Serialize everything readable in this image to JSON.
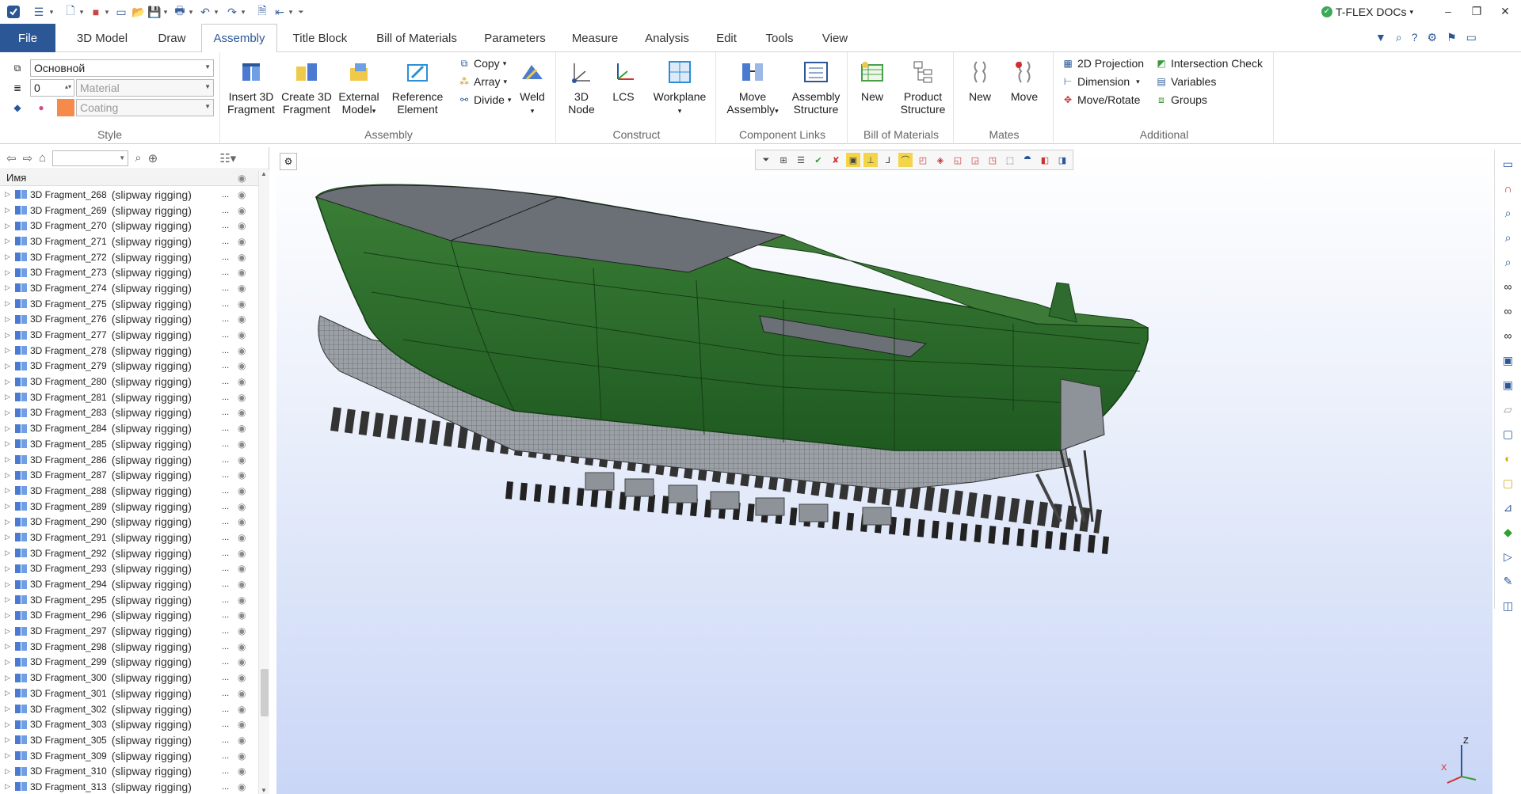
{
  "app": {
    "product": "T-FLEX DOCs"
  },
  "menu": {
    "file": "File",
    "tabs": [
      "3D Model",
      "Draw",
      "Assembly",
      "Title Block",
      "Bill of Materials",
      "Parameters",
      "Measure",
      "Analysis",
      "Edit",
      "Tools",
      "View"
    ],
    "active": "Assembly"
  },
  "ribbon": {
    "style": {
      "label": "Style",
      "layer_value": "Основной",
      "number_value": "0",
      "material_placeholder": "Material",
      "coating_placeholder": "Coating",
      "coating_color": "#f58a4b"
    },
    "assembly": {
      "label": "Assembly",
      "insert": "Insert 3D Fragment",
      "create": "Create 3D Fragment",
      "external": "External Model",
      "reference": "Reference Element",
      "copy": "Copy",
      "array": "Array",
      "divide": "Divide",
      "weld": "Weld"
    },
    "construct": {
      "label": "Construct",
      "node": "3D Node",
      "lcs": "LCS",
      "workplane": "Workplane"
    },
    "component_links": {
      "label": "Component Links",
      "move_assembly": "Move Assembly",
      "assembly_structure": "Assembly Structure"
    },
    "bom": {
      "label": "Bill of Materials",
      "new": "New",
      "product_structure": "Product Structure"
    },
    "mates": {
      "label": "Mates",
      "new": "New",
      "move": "Move"
    },
    "additional": {
      "label": "Additional",
      "projection": "2D Projection",
      "dimension": "Dimension",
      "move_rotate": "Move/Rotate",
      "intersection": "Intersection Check",
      "variables": "Variables",
      "groups": "Groups"
    }
  },
  "tree": {
    "header": "Имя",
    "rows": [
      {
        "name": "3D Fragment_268",
        "sub": "(slipway rigging)"
      },
      {
        "name": "3D Fragment_269",
        "sub": "(slipway rigging)"
      },
      {
        "name": "3D Fragment_270",
        "sub": "(slipway rigging)"
      },
      {
        "name": "3D Fragment_271",
        "sub": "(slipway rigging)"
      },
      {
        "name": "3D Fragment_272",
        "sub": "(slipway rigging)"
      },
      {
        "name": "3D Fragment_273",
        "sub": "(slipway rigging)"
      },
      {
        "name": "3D Fragment_274",
        "sub": "(slipway rigging)"
      },
      {
        "name": "3D Fragment_275",
        "sub": "(slipway rigging)"
      },
      {
        "name": "3D Fragment_276",
        "sub": "(slipway rigging)"
      },
      {
        "name": "3D Fragment_277",
        "sub": "(slipway rigging)"
      },
      {
        "name": "3D Fragment_278",
        "sub": "(slipway rigging)"
      },
      {
        "name": "3D Fragment_279",
        "sub": "(slipway rigging)"
      },
      {
        "name": "3D Fragment_280",
        "sub": "(slipway rigging)"
      },
      {
        "name": "3D Fragment_281",
        "sub": "(slipway rigging)"
      },
      {
        "name": "3D Fragment_283",
        "sub": "(slipway rigging)"
      },
      {
        "name": "3D Fragment_284",
        "sub": "(slipway rigging)"
      },
      {
        "name": "3D Fragment_285",
        "sub": "(slipway rigging)"
      },
      {
        "name": "3D Fragment_286",
        "sub": "(slipway rigging)"
      },
      {
        "name": "3D Fragment_287",
        "sub": "(slipway rigging)"
      },
      {
        "name": "3D Fragment_288",
        "sub": "(slipway rigging)"
      },
      {
        "name": "3D Fragment_289",
        "sub": "(slipway rigging)"
      },
      {
        "name": "3D Fragment_290",
        "sub": "(slipway rigging)"
      },
      {
        "name": "3D Fragment_291",
        "sub": "(slipway rigging)"
      },
      {
        "name": "3D Fragment_292",
        "sub": "(slipway rigging)"
      },
      {
        "name": "3D Fragment_293",
        "sub": "(slipway rigging)"
      },
      {
        "name": "3D Fragment_294",
        "sub": "(slipway rigging)"
      },
      {
        "name": "3D Fragment_295",
        "sub": "(slipway rigging)"
      },
      {
        "name": "3D Fragment_296",
        "sub": "(slipway rigging)"
      },
      {
        "name": "3D Fragment_297",
        "sub": "(slipway rigging)"
      },
      {
        "name": "3D Fragment_298",
        "sub": "(slipway rigging)"
      },
      {
        "name": "3D Fragment_299",
        "sub": "(slipway rigging)"
      },
      {
        "name": "3D Fragment_300",
        "sub": "(slipway rigging)"
      },
      {
        "name": "3D Fragment_301",
        "sub": "(slipway rigging)"
      },
      {
        "name": "3D Fragment_302",
        "sub": "(slipway rigging)"
      },
      {
        "name": "3D Fragment_303",
        "sub": "(slipway rigging)"
      },
      {
        "name": "3D Fragment_305",
        "sub": "(slipway rigging)"
      },
      {
        "name": "3D Fragment_309",
        "sub": "(slipway rigging)"
      },
      {
        "name": "3D Fragment_310",
        "sub": "(slipway rigging)"
      },
      {
        "name": "3D Fragment_313",
        "sub": "(slipway rigging)"
      }
    ]
  },
  "axes": {
    "x": "X",
    "z": "Z"
  },
  "colors": {
    "accent": "#2b5797",
    "hull": "#2f6b2f",
    "deck": "#6b6f76"
  }
}
